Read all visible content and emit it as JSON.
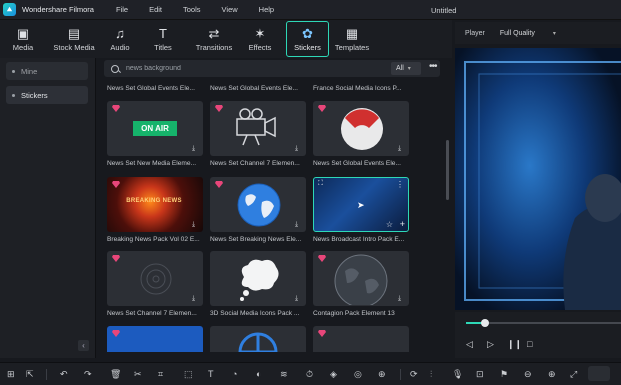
{
  "app": {
    "name": "Wondershare Filmora",
    "menu": [
      "File",
      "Edit",
      "Tools",
      "View",
      "Help"
    ],
    "project_title": "Untitled"
  },
  "toolbar": [
    {
      "label": "Media",
      "icon": "media-icon",
      "glyph": "▣"
    },
    {
      "label": "Stock Media",
      "icon": "stock-media-icon",
      "glyph": "▤"
    },
    {
      "label": "Audio",
      "icon": "music-note-icon",
      "glyph": "♫"
    },
    {
      "label": "Titles",
      "icon": "text-t-icon",
      "glyph": "T"
    },
    {
      "label": "Transitions",
      "icon": "transitions-icon",
      "glyph": "⇄"
    },
    {
      "label": "Effects",
      "icon": "effects-sparkle-icon",
      "glyph": "✶"
    },
    {
      "label": "Stickers",
      "icon": "stickers-icon",
      "glyph": "✿",
      "active": true
    },
    {
      "label": "Templates",
      "icon": "templates-icon",
      "glyph": "▦"
    }
  ],
  "sidebar": {
    "items": [
      {
        "label": "Mine"
      },
      {
        "label": "Stickers"
      }
    ]
  },
  "search": {
    "value": "news background",
    "filter": "All"
  },
  "stickers": {
    "top_captions": [
      "News Set Global Events Ele...",
      "News Set Global Events Ele...",
      "France Social Media Icons P..."
    ],
    "rows": [
      [
        {
          "caption": "News Set New Media Eleme...",
          "thumb": "on-air",
          "text": "ON AIR"
        },
        {
          "caption": "News Set Channel 7 Elemen...",
          "thumb": "camera"
        },
        {
          "caption": "News Set Global Events Ele...",
          "thumb": "red-sphere"
        }
      ],
      [
        {
          "caption": "Breaking News Pack Vol 02 E...",
          "thumb": "breaking-news",
          "text": "BREAKING NEWS"
        },
        {
          "caption": "News Set Breaking News Ele...",
          "thumb": "globe"
        },
        {
          "caption": "News Broadcast Intro Pack E...",
          "thumb": "broadcast",
          "selected": true
        }
      ],
      [
        {
          "caption": "News Set Channel 7 Elemen...",
          "thumb": "radar"
        },
        {
          "caption": "3D Social Media Icons Pack ...",
          "thumb": "speech-bubble"
        },
        {
          "caption": "Contagion Pack Element 13",
          "thumb": "dark-globe"
        }
      ]
    ]
  },
  "player": {
    "label": "Player",
    "quality": "Full Quality",
    "progress_percent": 12
  },
  "colors": {
    "accent": "#2ed8b7",
    "premium_gem": "#e8467a",
    "on_air_green": "#16b36b"
  }
}
